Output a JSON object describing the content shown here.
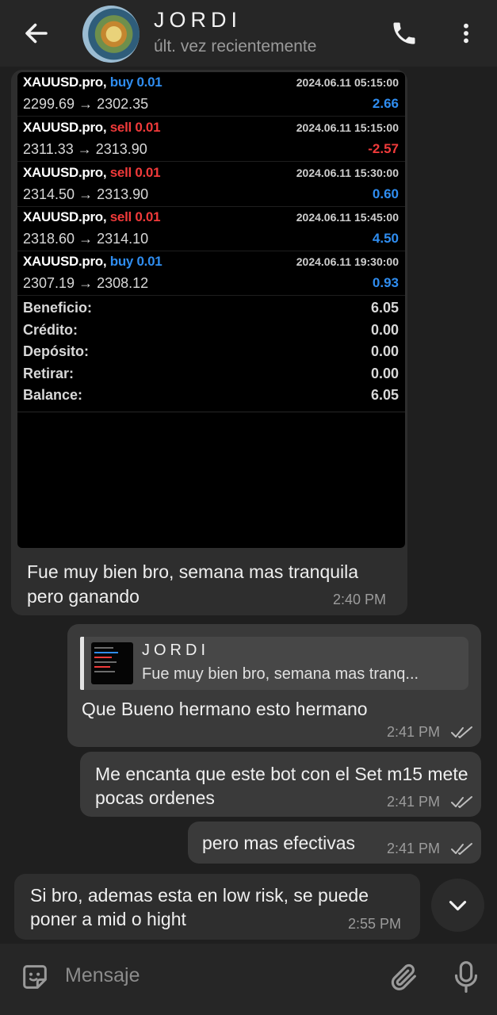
{
  "header": {
    "contact_name": "JORDI",
    "last_seen": "últ. vez recientemente"
  },
  "report": {
    "trades": [
      {
        "symbol": "XAUUSD.pro,",
        "direction": "buy 0.01",
        "datetime": "2024.06.11 05:15:00",
        "prices": "2299.69 → 2302.35",
        "profit": "2.66",
        "profit_positive": true
      },
      {
        "symbol": "XAUUSD.pro,",
        "direction": "sell 0.01",
        "datetime": "2024.06.11 15:15:00",
        "prices": "2311.33 → 2313.90",
        "profit": "-2.57",
        "profit_positive": false
      },
      {
        "symbol": "XAUUSD.pro,",
        "direction": "sell 0.01",
        "datetime": "2024.06.11 15:30:00",
        "prices": "2314.50 → 2313.90",
        "profit": "0.60",
        "profit_positive": true
      },
      {
        "symbol": "XAUUSD.pro,",
        "direction": "sell 0.01",
        "datetime": "2024.06.11 15:45:00",
        "prices": "2318.60 → 2314.10",
        "profit": "4.50",
        "profit_positive": true
      },
      {
        "symbol": "XAUUSD.pro,",
        "direction": "buy 0.01",
        "datetime": "2024.06.11 19:30:00",
        "prices": "2307.19 → 2308.12",
        "profit": "0.93",
        "profit_positive": true
      }
    ],
    "summary": [
      {
        "label": "Beneficio:",
        "value": "6.05"
      },
      {
        "label": "Crédito:",
        "value": "0.00"
      },
      {
        "label": "Depósito:",
        "value": "0.00"
      },
      {
        "label": "Retirar:",
        "value": "0.00"
      },
      {
        "label": "Balance:",
        "value": "6.05"
      }
    ]
  },
  "messages": [
    {
      "text": "Fue muy bien bro, semana mas tranquila pero ganando",
      "time": "2:40 PM"
    },
    {
      "reply_name": "JORDI",
      "reply_text": "Fue muy bien bro, semana mas tranq...",
      "text": "Que Bueno hermano esto hermano",
      "time": "2:41 PM"
    },
    {
      "text": "Me encanta que este bot con el Set m15 mete pocas ordenes",
      "time": "2:41 PM"
    },
    {
      "text": "pero mas efectivas",
      "time": "2:41 PM"
    },
    {
      "text": "Si bro, ademas esta en low risk, se puede poner a mid o hight",
      "time": "2:55 PM"
    }
  ],
  "composer": {
    "placeholder": "Mensaje"
  },
  "icons": {
    "back": "arrow-left-icon",
    "phone": "phone-icon",
    "more": "more-vertical-icon",
    "read": "double-check-icon",
    "scroll": "chevron-down-icon",
    "emoji": "sticker-emoji-icon",
    "attach": "paperclip-icon",
    "mic": "microphone-icon"
  },
  "colors": {
    "buy": "#2f8df0",
    "sell": "#f03a3a",
    "background": "#1f1f1f",
    "bubble_in": "#2e2e2e",
    "bubble_out": "#3a3a3a"
  }
}
